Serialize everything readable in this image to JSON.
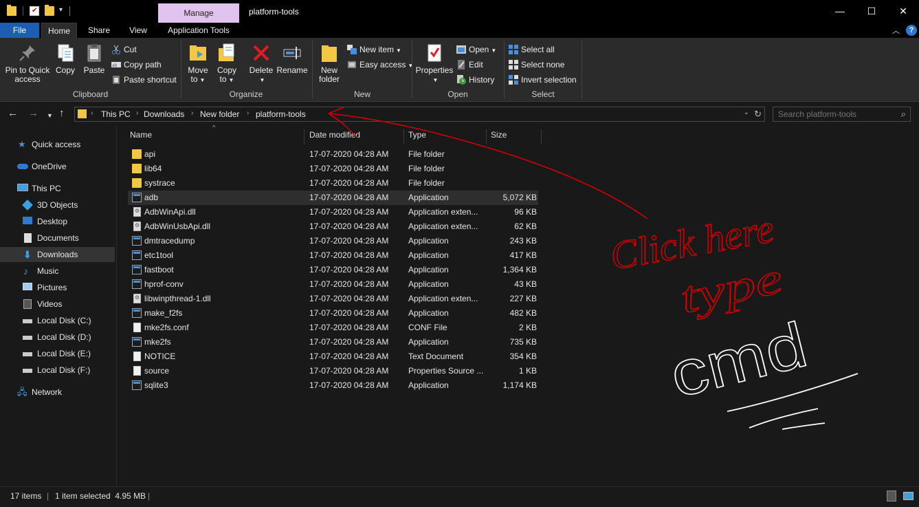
{
  "window": {
    "title": "platform-tools",
    "contextual_tab_group": "Manage",
    "controls": {
      "minimize": "—",
      "maximize": "☐",
      "close": "✕"
    }
  },
  "tabs": {
    "file": "File",
    "home": "Home",
    "share": "Share",
    "view": "View",
    "application_tools": "Application Tools"
  },
  "ribbon": {
    "clipboard": {
      "label": "Clipboard",
      "pin_line1": "Pin to Quick",
      "pin_line2": "access",
      "copy": "Copy",
      "paste": "Paste",
      "cut": "Cut",
      "copy_path": "Copy path",
      "paste_shortcut": "Paste shortcut"
    },
    "organize": {
      "label": "Organize",
      "move_line1": "Move",
      "move_line2": "to",
      "copy_line1": "Copy",
      "copy_line2": "to",
      "delete": "Delete",
      "rename": "Rename"
    },
    "new": {
      "label": "New",
      "new_folder_line1": "New",
      "new_folder_line2": "folder",
      "new_item": "New item",
      "easy_access": "Easy access"
    },
    "open": {
      "label": "Open",
      "properties": "Properties",
      "open": "Open",
      "edit": "Edit",
      "history": "History"
    },
    "select": {
      "label": "Select",
      "select_all": "Select all",
      "select_none": "Select none",
      "invert_selection": "Invert selection"
    }
  },
  "address": {
    "crumbs": [
      "This PC",
      "Downloads",
      "New folder",
      "platform-tools"
    ],
    "search_placeholder": "Search platform-tools"
  },
  "nav_pane": {
    "quick_access": "Quick access",
    "onedrive": "OneDrive",
    "this_pc": "This PC",
    "objects3d": "3D Objects",
    "desktop": "Desktop",
    "documents": "Documents",
    "downloads": "Downloads",
    "music": "Music",
    "pictures": "Pictures",
    "videos": "Videos",
    "disk_c": "Local Disk (C:)",
    "disk_d": "Local Disk (D:)",
    "disk_e": "Local Disk (E:)",
    "disk_f": "Local Disk (F:)",
    "network": "Network"
  },
  "columns": {
    "name": "Name",
    "date": "Date modified",
    "type": "Type",
    "size": "Size"
  },
  "files": [
    {
      "name": "api",
      "date": "17-07-2020 04:28 AM",
      "type": "File folder",
      "size": "",
      "icon": "folder"
    },
    {
      "name": "lib64",
      "date": "17-07-2020 04:28 AM",
      "type": "File folder",
      "size": "",
      "icon": "folder"
    },
    {
      "name": "systrace",
      "date": "17-07-2020 04:28 AM",
      "type": "File folder",
      "size": "",
      "icon": "folder"
    },
    {
      "name": "adb",
      "date": "17-07-2020 04:28 AM",
      "type": "Application",
      "size": "5,072 KB",
      "icon": "app"
    },
    {
      "name": "AdbWinApi.dll",
      "date": "17-07-2020 04:28 AM",
      "type": "Application exten...",
      "size": "96 KB",
      "icon": "dll"
    },
    {
      "name": "AdbWinUsbApi.dll",
      "date": "17-07-2020 04:28 AM",
      "type": "Application exten...",
      "size": "62 KB",
      "icon": "dll"
    },
    {
      "name": "dmtracedump",
      "date": "17-07-2020 04:28 AM",
      "type": "Application",
      "size": "243 KB",
      "icon": "app"
    },
    {
      "name": "etc1tool",
      "date": "17-07-2020 04:28 AM",
      "type": "Application",
      "size": "417 KB",
      "icon": "app"
    },
    {
      "name": "fastboot",
      "date": "17-07-2020 04:28 AM",
      "type": "Application",
      "size": "1,364 KB",
      "icon": "app"
    },
    {
      "name": "hprof-conv",
      "date": "17-07-2020 04:28 AM",
      "type": "Application",
      "size": "43 KB",
      "icon": "app"
    },
    {
      "name": "libwinpthread-1.dll",
      "date": "17-07-2020 04:28 AM",
      "type": "Application exten...",
      "size": "227 KB",
      "icon": "dll"
    },
    {
      "name": "make_f2fs",
      "date": "17-07-2020 04:28 AM",
      "type": "Application",
      "size": "482 KB",
      "icon": "app"
    },
    {
      "name": "mke2fs.conf",
      "date": "17-07-2020 04:28 AM",
      "type": "CONF File",
      "size": "2 KB",
      "icon": "doc"
    },
    {
      "name": "mke2fs",
      "date": "17-07-2020 04:28 AM",
      "type": "Application",
      "size": "735 KB",
      "icon": "app"
    },
    {
      "name": "NOTICE",
      "date": "17-07-2020 04:28 AM",
      "type": "Text Document",
      "size": "354 KB",
      "icon": "doc"
    },
    {
      "name": "source",
      "date": "17-07-2020 04:28 AM",
      "type": "Properties Source ...",
      "size": "1 KB",
      "icon": "doc"
    },
    {
      "name": "sqlite3",
      "date": "17-07-2020 04:28 AM",
      "type": "Application",
      "size": "1,174 KB",
      "icon": "app"
    }
  ],
  "selected_file": "adb",
  "status": {
    "items": "17 items",
    "selected": "1 item selected  4.95 MB"
  },
  "annotation": {
    "text_line1": "Click here",
    "text_line2": "type",
    "text_line3": "cmd",
    "color": "#d40000",
    "color2": "#ffffff"
  }
}
